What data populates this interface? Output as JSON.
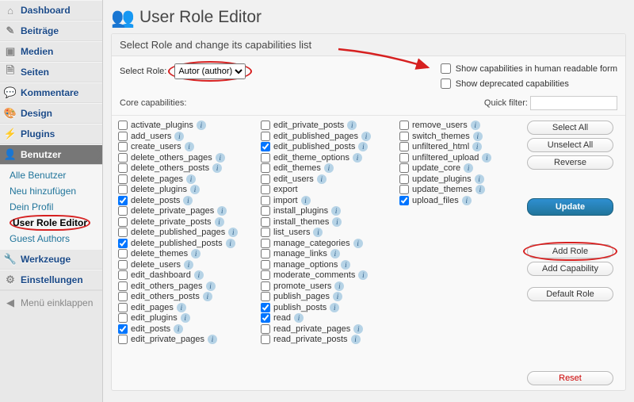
{
  "sidebar": {
    "items": [
      {
        "label": "Dashboard",
        "icon": "⌂"
      },
      {
        "label": "Beiträge",
        "icon": "✎"
      },
      {
        "label": "Medien",
        "icon": "▣"
      },
      {
        "label": "Seiten",
        "icon": "🗎"
      },
      {
        "label": "Kommentare",
        "icon": "💬"
      },
      {
        "label": "Design",
        "icon": "🎨"
      },
      {
        "label": "Plugins",
        "icon": "⚡"
      },
      {
        "label": "Benutzer",
        "icon": "👤"
      },
      {
        "label": "Werkzeuge",
        "icon": "🔧"
      },
      {
        "label": "Einstellungen",
        "icon": "⚙"
      }
    ],
    "sub_items": [
      {
        "label": "Alle Benutzer"
      },
      {
        "label": "Neu hinzufügen"
      },
      {
        "label": "Dein Profil"
      },
      {
        "label": "User Role Editor"
      },
      {
        "label": "Guest Authors"
      }
    ],
    "collapse_label": "Menü einklappen"
  },
  "page": {
    "title": "User Role Editor",
    "panel_title": "Select Role and change its capabilities list",
    "select_role_label": "Select Role:",
    "selected_role": "Autor (author)",
    "opt_human": "Show capabilities in human readable form",
    "opt_deprecated": "Show deprecated capabilities",
    "core_label": "Core capabilities:",
    "quick_filter_label": "Quick filter:",
    "quick_filter_value": ""
  },
  "buttons": {
    "select_all": "Select All",
    "unselect_all": "Unselect All",
    "reverse": "Reverse",
    "update": "Update",
    "add_role": "Add Role",
    "add_capability": "Add Capability",
    "default_role": "Default Role",
    "reset": "Reset"
  },
  "caps": {
    "col1": [
      {
        "label": "activate_plugins",
        "checked": false,
        "help": true
      },
      {
        "label": "add_users",
        "checked": false,
        "help": true
      },
      {
        "label": "create_users",
        "checked": false,
        "help": true
      },
      {
        "label": "delete_others_pages",
        "checked": false,
        "help": true
      },
      {
        "label": "delete_others_posts",
        "checked": false,
        "help": true
      },
      {
        "label": "delete_pages",
        "checked": false,
        "help": true
      },
      {
        "label": "delete_plugins",
        "checked": false,
        "help": true
      },
      {
        "label": "delete_posts",
        "checked": true,
        "help": true
      },
      {
        "label": "delete_private_pages",
        "checked": false,
        "help": true
      },
      {
        "label": "delete_private_posts",
        "checked": false,
        "help": true
      },
      {
        "label": "delete_published_pages",
        "checked": false,
        "help": true
      },
      {
        "label": "delete_published_posts",
        "checked": true,
        "help": true
      },
      {
        "label": "delete_themes",
        "checked": false,
        "help": true
      },
      {
        "label": "delete_users",
        "checked": false,
        "help": true
      },
      {
        "label": "edit_dashboard",
        "checked": false,
        "help": true
      },
      {
        "label": "edit_others_pages",
        "checked": false,
        "help": true
      },
      {
        "label": "edit_others_posts",
        "checked": false,
        "help": true
      },
      {
        "label": "edit_pages",
        "checked": false,
        "help": true
      },
      {
        "label": "edit_plugins",
        "checked": false,
        "help": true
      },
      {
        "label": "edit_posts",
        "checked": true,
        "help": true
      },
      {
        "label": "edit_private_pages",
        "checked": false,
        "help": true
      }
    ],
    "col2": [
      {
        "label": "edit_private_posts",
        "checked": false,
        "help": true
      },
      {
        "label": "edit_published_pages",
        "checked": false,
        "help": true
      },
      {
        "label": "edit_published_posts",
        "checked": true,
        "help": true
      },
      {
        "label": "edit_theme_options",
        "checked": false,
        "help": true
      },
      {
        "label": "edit_themes",
        "checked": false,
        "help": true
      },
      {
        "label": "edit_users",
        "checked": false,
        "help": true
      },
      {
        "label": "export",
        "checked": false,
        "help": false
      },
      {
        "label": "import",
        "checked": false,
        "help": true
      },
      {
        "label": "install_plugins",
        "checked": false,
        "help": true
      },
      {
        "label": "install_themes",
        "checked": false,
        "help": true
      },
      {
        "label": "list_users",
        "checked": false,
        "help": true
      },
      {
        "label": "manage_categories",
        "checked": false,
        "help": true
      },
      {
        "label": "manage_links",
        "checked": false,
        "help": true
      },
      {
        "label": "manage_options",
        "checked": false,
        "help": true
      },
      {
        "label": "moderate_comments",
        "checked": false,
        "help": true
      },
      {
        "label": "promote_users",
        "checked": false,
        "help": true
      },
      {
        "label": "publish_pages",
        "checked": false,
        "help": true
      },
      {
        "label": "publish_posts",
        "checked": true,
        "help": true
      },
      {
        "label": "read",
        "checked": true,
        "help": true
      },
      {
        "label": "read_private_pages",
        "checked": false,
        "help": true
      },
      {
        "label": "read_private_posts",
        "checked": false,
        "help": true
      }
    ],
    "col3": [
      {
        "label": "remove_users",
        "checked": false,
        "help": true
      },
      {
        "label": "switch_themes",
        "checked": false,
        "help": true
      },
      {
        "label": "unfiltered_html",
        "checked": false,
        "help": true
      },
      {
        "label": "unfiltered_upload",
        "checked": false,
        "help": true
      },
      {
        "label": "update_core",
        "checked": false,
        "help": true
      },
      {
        "label": "update_plugins",
        "checked": false,
        "help": true
      },
      {
        "label": "update_themes",
        "checked": false,
        "help": true
      },
      {
        "label": "upload_files",
        "checked": true,
        "help": true
      }
    ]
  }
}
